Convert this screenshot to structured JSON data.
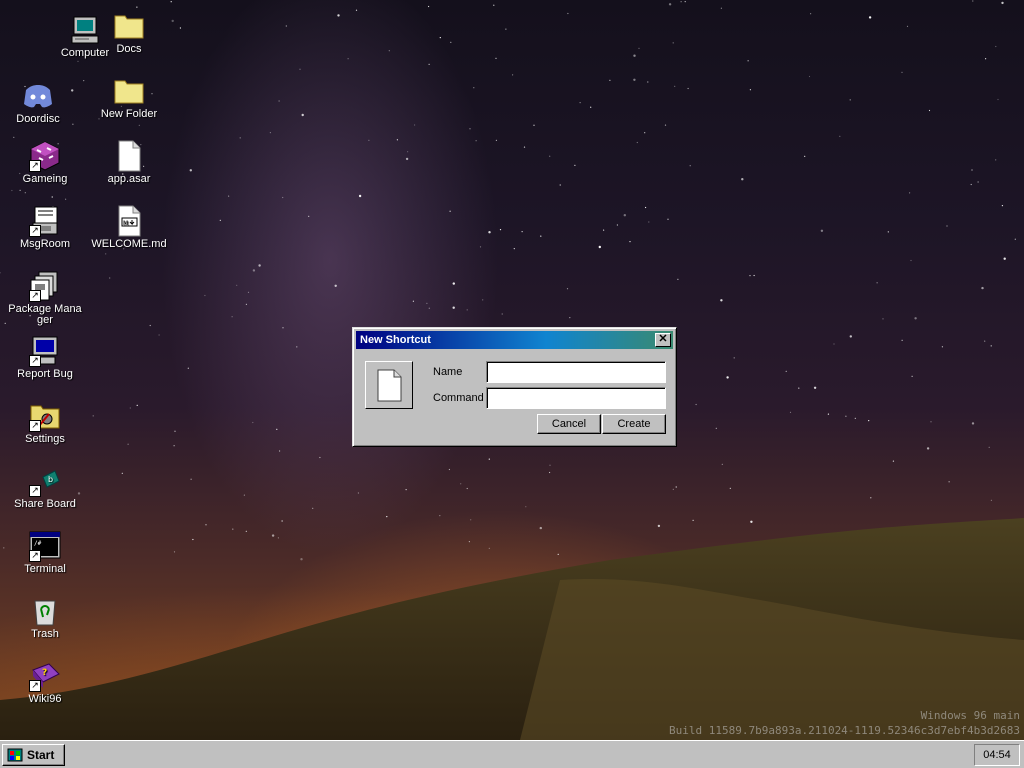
{
  "desktop": {
    "icons_left": [
      {
        "label": "Computer",
        "icon": "computer-icon"
      },
      {
        "label": "Doordisc",
        "icon": "discord-icon"
      },
      {
        "label": "Gameing",
        "icon": "game-icon"
      },
      {
        "label": "MsgRoom",
        "icon": "msgroom-icon"
      },
      {
        "label": "Package Manager",
        "icon": "package-manager-icon"
      },
      {
        "label": "Report Bug",
        "icon": "report-bug-icon"
      },
      {
        "label": "Settings",
        "icon": "settings-icon"
      },
      {
        "label": "Share Board",
        "icon": "share-board-icon"
      },
      {
        "label": "Terminal",
        "icon": "terminal-icon"
      },
      {
        "label": "Trash",
        "icon": "trash-icon"
      },
      {
        "label": "Wiki96",
        "icon": "wiki-book-icon"
      }
    ],
    "icons_right": [
      {
        "label": "Docs",
        "icon": "folder-icon"
      },
      {
        "label": "New Folder",
        "icon": "folder-icon"
      },
      {
        "label": "app.asar",
        "icon": "file-icon"
      },
      {
        "label": "WELCOME.md",
        "icon": "markdown-file-icon"
      }
    ],
    "watermark_line1": "Windows 96 main",
    "watermark_line2": "Build 11589.7b9a893a.211024-1119.52346c3d7ebf4b3d2683"
  },
  "dialog": {
    "title": "New Shortcut",
    "close_label": "✕",
    "name_label": "Name",
    "name_value": "",
    "command_label": "Command",
    "command_value": "",
    "cancel_label": "Cancel",
    "create_label": "Create"
  },
  "taskbar": {
    "start_label": "Start",
    "clock": "04:54"
  },
  "colors": {
    "titlebar_start": "#000080",
    "titlebar_end": "#3a8a70",
    "chrome": "#c0c0c0"
  }
}
